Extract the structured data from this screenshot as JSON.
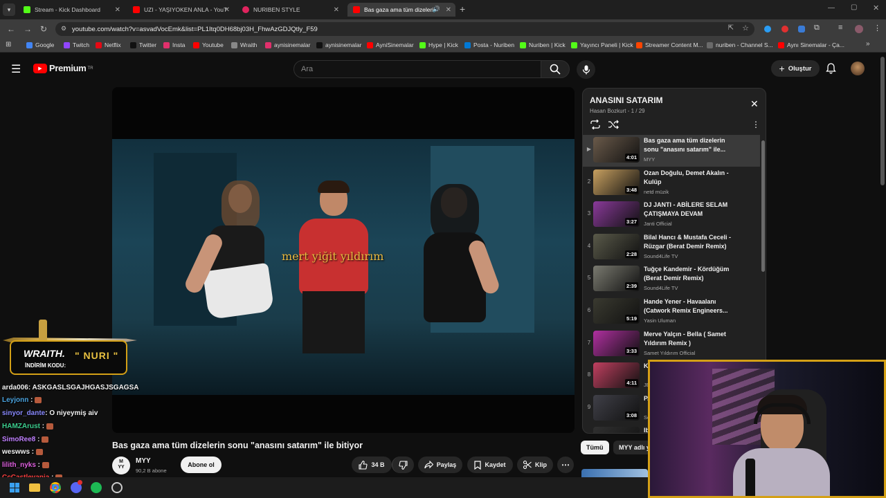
{
  "tabs": [
    {
      "title": "Stream - Kick Dashboard",
      "color": "#53fc18"
    },
    {
      "title": "UZI - YAŞIYOKEN ANLA - YouTube",
      "color": "#ff0000"
    },
    {
      "title": "NURIBEN STYLE",
      "color": "#e0245e"
    },
    {
      "title": "Bas gaza ama tüm dizelerin sonu",
      "color": "#ff0000"
    }
  ],
  "url": "youtube.com/watch?v=asvadVocEmk&list=PL1Itq0DH68bj03H_FhwAzGDJQtly_F59",
  "bookmarks": [
    {
      "label": "Google",
      "color": "#4285f4"
    },
    {
      "label": "Twitch",
      "color": "#9146ff"
    },
    {
      "label": "Netflix",
      "color": "#e50914"
    },
    {
      "label": "Twitter",
      "color": "#111111"
    },
    {
      "label": "Insta",
      "color": "#e1306c"
    },
    {
      "label": "Youtube",
      "color": "#ff0000"
    },
    {
      "label": "Wraith",
      "color": "#888888"
    },
    {
      "label": "aynisinemalar",
      "color": "#e1306c"
    },
    {
      "label": "aynisinemalar",
      "color": "#111111"
    },
    {
      "label": "AyniSinemalar",
      "color": "#ff0000"
    },
    {
      "label": "Hype | Kick",
      "color": "#53fc18"
    },
    {
      "label": "Posta - Nuriben",
      "color": "#0078d4"
    },
    {
      "label": "Nuriben | Kick",
      "color": "#53fc18"
    },
    {
      "label": "Yayıncı Paneli | Kick",
      "color": "#53fc18"
    },
    {
      "label": "Streamer Content M...",
      "color": "#ff4500"
    },
    {
      "label": "nuriben - Channel S...",
      "color": "#6a6a6a"
    },
    {
      "label": "Aynı Sinemalar - Ça...",
      "color": "#ff0000"
    }
  ],
  "header": {
    "logo_text": "Premium",
    "logo_sup": "TR",
    "search_placeholder": "Ara",
    "create_label": "Oluştur"
  },
  "video": {
    "caption": "mert yiğit yıldırım",
    "title": "Bas gaza ama tüm dizelerin sonu \"anasını satarım\" ile bitiyor",
    "channel_avatar": "M\nYY",
    "channel": "MYY",
    "subscribers": "90,2 B abone",
    "subscribe_label": "Abone ol",
    "likes": "34 B",
    "share_label": "Paylaş",
    "save_label": "Kaydet",
    "clip_label": "Klip"
  },
  "playlist": {
    "title": "ANASINI SATARIM",
    "meta": "Hasan Bozkurt - 1 / 29",
    "items": [
      {
        "num": "▶",
        "title": "Bas gaza ama tüm dizelerin sonu \"anasını satarım\" ile...",
        "channel": "MYY",
        "duration": "4:01",
        "active": true,
        "thumb": "#6a5a4a"
      },
      {
        "num": "2",
        "title": "Ozan Doğulu, Demet Akalın - Kulüp",
        "channel": "netd müzik",
        "duration": "3:48",
        "thumb": "#c8a060"
      },
      {
        "num": "3",
        "title": "DJ JANTI - ABİLERE SELAM ÇATIŞMAYA DEVAM",
        "channel": "Janti Official",
        "duration": "3:27",
        "thumb": "#8a3a9a"
      },
      {
        "num": "4",
        "title": "Bilal Hancı & Mustafa Ceceli - Rüzgar (Berat Demir Remix)",
        "channel": "Sound4Life TV",
        "duration": "2:28",
        "thumb": "#5a5a4a"
      },
      {
        "num": "5",
        "title": "Tuğçe Kandemir - Kördüğüm (Berat Demir Remix)",
        "channel": "Sound4Life TV",
        "duration": "2:39",
        "thumb": "#7a7a70"
      },
      {
        "num": "6",
        "title": "Hande Yener - Havaalanı (Catwork Remix Engineers...",
        "channel": "Yasin Uluman",
        "duration": "5:19",
        "thumb": "#3a3a30"
      },
      {
        "num": "7",
        "title": "Merve Yalçın - Bella ( Samet Yıldırım Remix )",
        "channel": "Samet Yıldırım Official",
        "duration": "3:33",
        "thumb": "#b030a0"
      },
      {
        "num": "8",
        "title": "K...",
        "channel": "JE...",
        "duration": "4:11",
        "thumb": "#c04060"
      },
      {
        "num": "9",
        "title": "P...",
        "channel": "Sc...",
        "duration": "3:08",
        "thumb": "#404048"
      },
      {
        "num": "10",
        "title": "Ib...",
        "channel": "",
        "duration": "",
        "thumb": "#303030"
      }
    ]
  },
  "filters": {
    "all": "Tümü",
    "channel": "MYY adlı y..."
  },
  "overlay": {
    "brand": "WRAITH.",
    "code_label": "İNDİRİM KODU:",
    "code": "\" NURI \""
  },
  "chat": [
    {
      "user": "arda006",
      "msg": ": ASKGASLSGAJHGASJSGAGSA",
      "color": "#f1f1f1",
      "emote": false
    },
    {
      "user": "Leyjonn",
      "msg": " :",
      "color": "#4aa3df",
      "emote": true
    },
    {
      "user": "sinyor_dante",
      "msg": ": O niyeymiş aiv",
      "color": "#8a8aff",
      "emote": false
    },
    {
      "user": "HAMZArust",
      "msg": " :",
      "color": "#3ccf8f",
      "emote": true
    },
    {
      "user": "SimoRee8",
      "msg": " :",
      "color": "#c080ff",
      "emote": true
    },
    {
      "user": "weswws",
      "msg": " :",
      "color": "#f1f1f1",
      "emote": true
    },
    {
      "user": "lilith_nyks",
      "msg": " :",
      "color": "#e060e0",
      "emote": true
    },
    {
      "user": "CcCastlevania",
      "msg": " :",
      "color": "#ff4040",
      "emote": true
    }
  ]
}
